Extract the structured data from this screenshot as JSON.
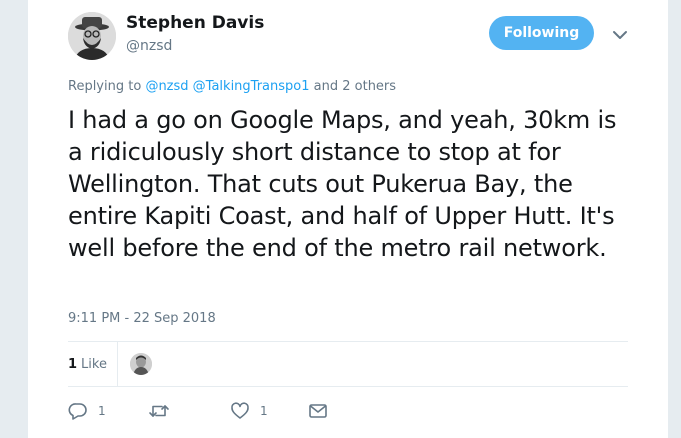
{
  "author": {
    "name": "Stephen Davis",
    "handle": "@nzsd"
  },
  "follow_button": {
    "label": "Following"
  },
  "replying": {
    "prefix": "Replying to ",
    "mention1": "@nzsd",
    "mention2": "@TalkingTranspo1",
    "suffix": " and 2 others"
  },
  "tweet": {
    "text": "I had a go on Google Maps, and yeah, 30km is a ridiculously short distance to stop at for Wellington. That cuts out Pukerua Bay, the entire Kapiti Coast, and half of Upper Hutt. It's well before the end of the metro rail network.",
    "timestamp": "9:11 PM - 22 Sep 2018"
  },
  "stats": {
    "likes_count": "1",
    "likes_label": "Like"
  },
  "actions": {
    "reply_count": "1",
    "retweet_count": "",
    "like_count": "1",
    "icons": [
      "reply-icon",
      "retweet-icon",
      "heart-icon",
      "mail-icon"
    ]
  },
  "colors": {
    "accent": "#1da1f2",
    "follow_button": "#53b3f2",
    "secondary_text": "#657786",
    "page_background": "#e6ecf0"
  }
}
